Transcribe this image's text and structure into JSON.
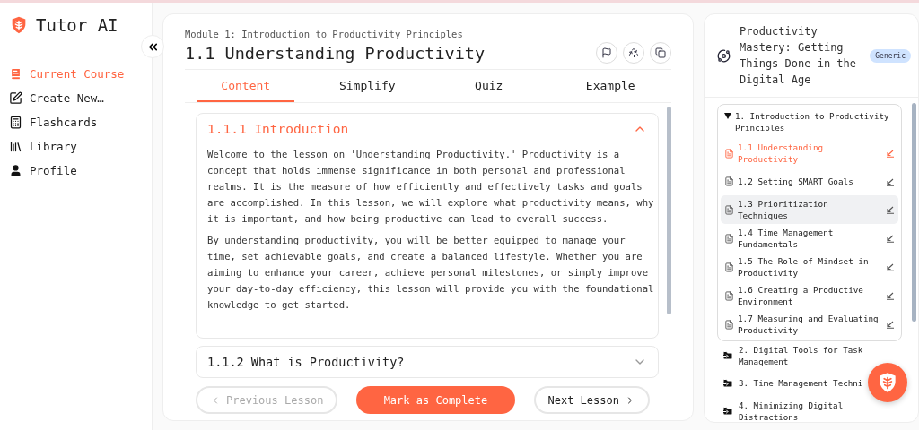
{
  "app": {
    "name": "Tutor AI"
  },
  "sidebar": {
    "items": [
      {
        "kind": "course",
        "label": "Current Course",
        "selected": true
      },
      {
        "kind": "create",
        "label": "Create New…",
        "selected": false
      },
      {
        "kind": "flashcards",
        "label": "Flashcards",
        "selected": false
      },
      {
        "kind": "library",
        "label": "Library",
        "selected": false
      },
      {
        "kind": "profile",
        "label": "Profile",
        "selected": false
      }
    ]
  },
  "lesson": {
    "module": "Module 1: Introduction to Productivity Principles",
    "title": "1.1 Understanding Productivity",
    "tabs": [
      {
        "label": "Content",
        "selected": true
      },
      {
        "label": "Simplify",
        "selected": false
      },
      {
        "label": "Quiz",
        "selected": false
      },
      {
        "label": "Example",
        "selected": false
      }
    ],
    "sections": [
      {
        "title": "1.1.1 Introduction",
        "expanded": true,
        "paragraphs": [
          "Welcome to the lesson on 'Understanding Productivity.' Productivity is a concept that holds immense significance in both personal and professional realms. It is the measure of how efficiently and effectively tasks and goals are accomplished. In this lesson, we will explore what productivity means, why it is important, and how being productive can lead to overall success.",
          "By understanding productivity, you will be better equipped to manage your time, set achievable goals, and create a balanced lifestyle. Whether you are aiming to enhance your career, achieve personal milestones, or simply improve your day-to-day efficiency, this lesson will provide you with the foundational knowledge to get started."
        ]
      },
      {
        "title": "1.1.2 What is Productivity?",
        "expanded": false
      }
    ],
    "buttons": {
      "previous": {
        "label": "Previous Lesson",
        "disabled": true
      },
      "complete": {
        "label": "Mark as Complete"
      },
      "next": {
        "label": "Next Lesson",
        "disabled": false
      }
    }
  },
  "course": {
    "title": "Productivity Mastery: Getting Things Done in the Digital Age",
    "badge": "Generic",
    "modules": [
      {
        "title": "1. Introduction to Productivity Principles",
        "expanded": true,
        "lessons": [
          {
            "title": "1.1 Understanding Productivity",
            "selected": true,
            "highlighted": false
          },
          {
            "title": "1.2 Setting SMART Goals",
            "selected": false,
            "highlighted": false
          },
          {
            "title": "1.3 Prioritization Techniques",
            "selected": false,
            "highlighted": true
          },
          {
            "title": "1.4 Time Management Fundamentals",
            "selected": false,
            "highlighted": false
          },
          {
            "title": "1.5 The Role of Mindset in Productivity",
            "selected": false,
            "highlighted": false
          },
          {
            "title": "1.6 Creating a Productive Environment",
            "selected": false,
            "highlighted": false
          },
          {
            "title": "1.7 Measuring and Evaluating Productivity",
            "selected": false,
            "highlighted": false
          }
        ]
      },
      {
        "title": "2. Digital Tools for Task Management",
        "expanded": false
      },
      {
        "title": "3. Time Management Techni",
        "expanded": false
      },
      {
        "title": "4. Minimizing Digital Distractions",
        "expanded": false
      }
    ]
  }
}
